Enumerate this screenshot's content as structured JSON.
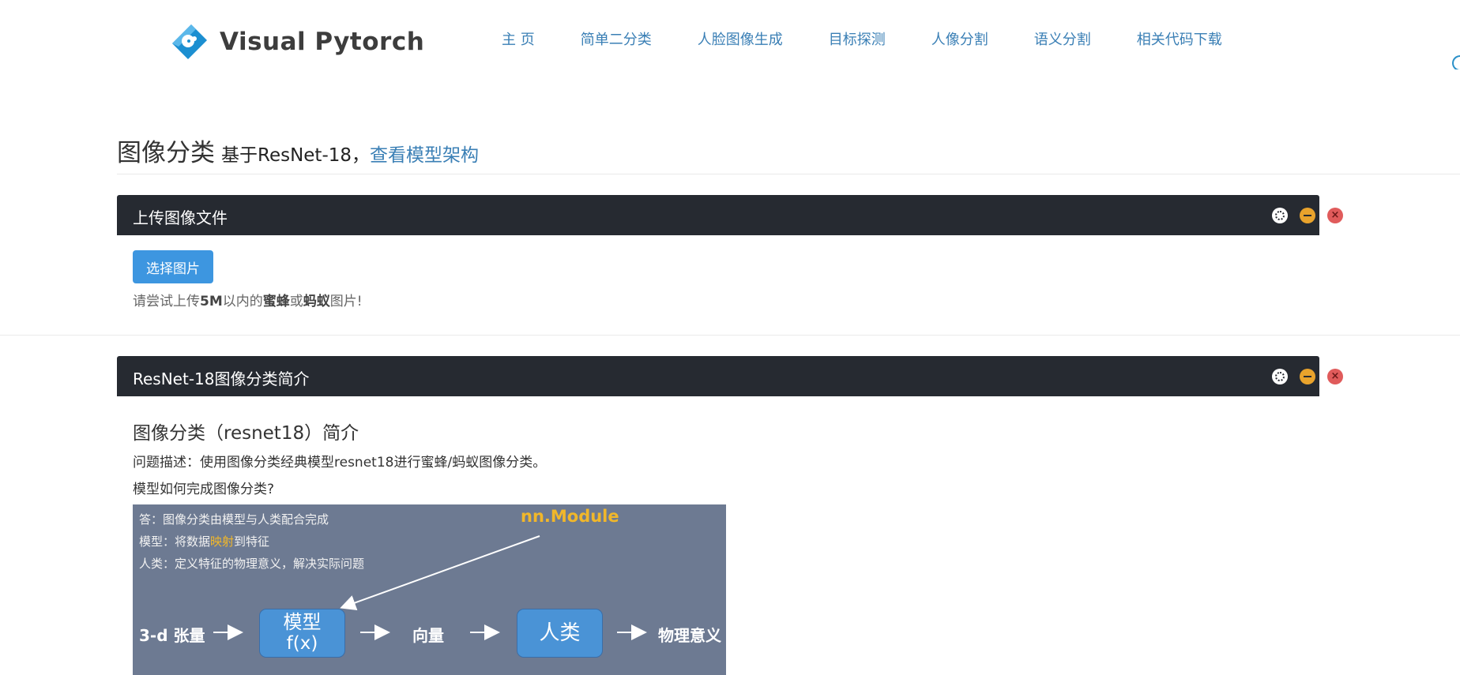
{
  "nav": {
    "logo_text": "Visual Pytorch",
    "links": [
      "主 页",
      "简单二分类",
      "人脸图像生成",
      "目标探测",
      "人像分割",
      "语义分割",
      "相关代码下载"
    ]
  },
  "header": {
    "title": "图像分类",
    "subtitle": "基于ResNet-18，",
    "link": "查看模型架构"
  },
  "upload_panel": {
    "title": "上传图像文件",
    "button": "选择图片",
    "hint_parts": [
      "请尝试上传",
      "5M",
      "以内的",
      "蜜蜂",
      "或",
      "蚂蚁",
      "图片!"
    ]
  },
  "intro_panel": {
    "title": "ResNet-18图像分类简介",
    "heading": "图像分类（resnet18）简介",
    "p1": "问题描述：使用图像分类经典模型resnet18进行蜜蜂/蚂蚁图像分类。",
    "p2": "模型如何完成图像分类?"
  },
  "figure": {
    "line1": "答：图像分类由模型与人类配合完成",
    "line2_a": "模型：将数据",
    "line2_hl": "映射",
    "line2_b": "到特征",
    "line3": "人类：定义特征的物理意义，解决实际问题",
    "nn_label": "nn.Module",
    "input": "3-d 张量",
    "model_line1": "模型",
    "model_line2": "f(x)",
    "vector": "向量",
    "human": "人类",
    "output": "物理意义"
  },
  "colors": {
    "accent": "#3a7fb5",
    "panel_header": "#262a31",
    "button": "#3d96e0",
    "highlight": "#f1b72a",
    "figure_bg": "#6d7a92"
  }
}
